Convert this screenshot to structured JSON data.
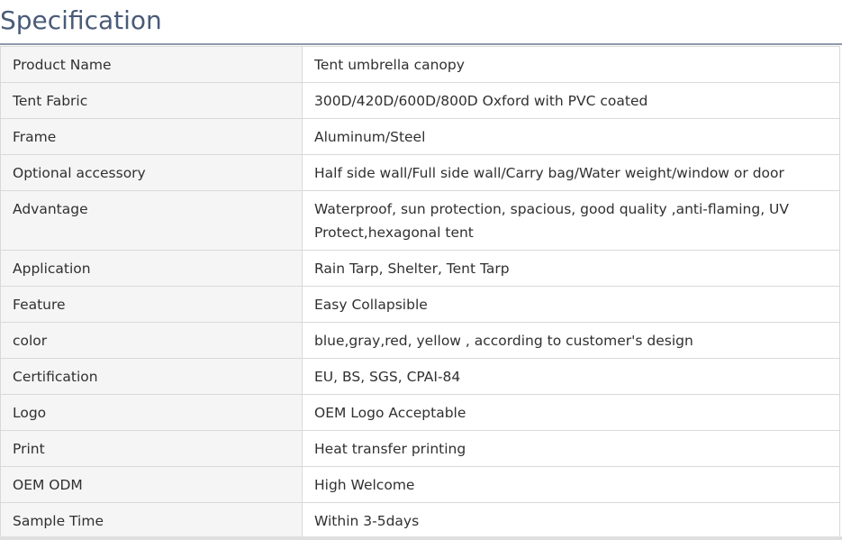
{
  "heading": "Specification",
  "rows": [
    {
      "label": "Product Name",
      "value": "Tent umbrella canopy"
    },
    {
      "label": "Tent Fabric",
      "value": "300D/420D/600D/800D Oxford with PVC coated"
    },
    {
      "label": "Frame",
      "value": "Aluminum/Steel"
    },
    {
      "label": "Optional accessory",
      "value": "Half side wall/Full side wall/Carry bag/Water weight/window or door"
    },
    {
      "label": "Advantage",
      "value": "Waterproof, sun protection, spacious, good quality ,anti-flaming, UV Protect,hexagonal tent"
    },
    {
      "label": "Application",
      "value": "Rain Tarp, Shelter, Tent Tarp"
    },
    {
      "label": "Feature",
      "value": "Easy Collapsible"
    },
    {
      "label": "color",
      "value": "blue,gray,red, yellow , according to customer's design"
    },
    {
      "label": "Certification",
      "value": "EU, BS, SGS, CPAI-84"
    },
    {
      "label": "Logo",
      "value": "OEM Logo Acceptable"
    },
    {
      "label": "Print",
      "value": "Heat transfer printing"
    },
    {
      "label": "OEM ODM",
      "value": "High Welcome"
    },
    {
      "label": "Sample Time",
      "value": "Within 3-5days"
    }
  ],
  "colors": {
    "heading": "#4a5a78",
    "rule": "#8d98a9",
    "label_background": "#f5f5f5",
    "border": "#d9d9d9",
    "text": "#303030"
  }
}
